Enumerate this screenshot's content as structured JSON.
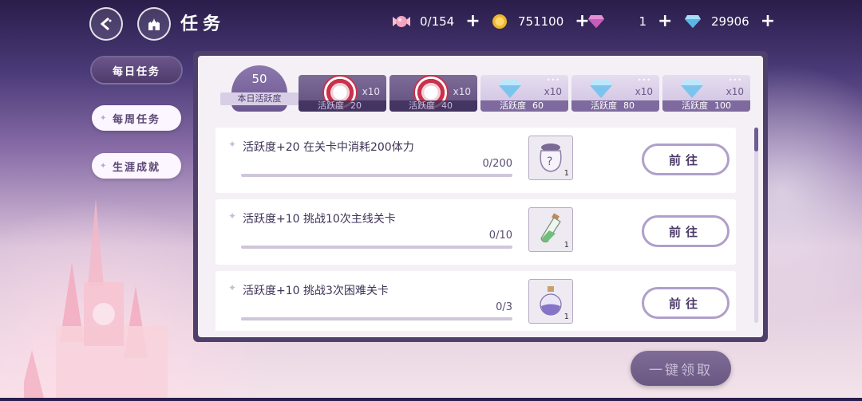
{
  "header": {
    "title": "任务"
  },
  "currencies": [
    {
      "icon": "candy-icon",
      "value": "0/154"
    },
    {
      "icon": "gold-coin-icon",
      "value": "751100"
    },
    {
      "icon": "pink-diamond-icon",
      "value": "1"
    },
    {
      "icon": "blue-diamond-icon",
      "value": "29906"
    }
  ],
  "sidebar": {
    "tabs": [
      {
        "label": "每日任务",
        "active": true
      },
      {
        "label": "每周任务",
        "active": false
      },
      {
        "label": "生涯成就",
        "active": false
      }
    ]
  },
  "activity": {
    "score": "50",
    "score_label": "本日活跃度",
    "tiers": [
      {
        "label": "活跃度",
        "value": "20",
        "qty": "x10",
        "claimed": true
      },
      {
        "label": "活跃度",
        "value": "40",
        "qty": "x10",
        "claimed": true
      },
      {
        "label": "活跃度",
        "value": "60",
        "qty": "x10",
        "claimed": false
      },
      {
        "label": "活跃度",
        "value": "80",
        "qty": "x10",
        "claimed": false
      },
      {
        "label": "活跃度",
        "value": "100",
        "qty": "x10",
        "claimed": false
      }
    ]
  },
  "tasks": [
    {
      "title": "活跃度+20 在关卡中消耗200体力",
      "progress": "0/200",
      "progress_fraction": 0,
      "reward_icon": "mystery-bag-icon",
      "reward_count": "1",
      "button": "前往"
    },
    {
      "title": "活跃度+10 挑战10次主线关卡",
      "progress": "0/10",
      "progress_fraction": 0,
      "reward_icon": "potion-vial-icon",
      "reward_count": "1",
      "button": "前往"
    },
    {
      "title": "活跃度+10 挑战3次困难关卡",
      "progress": "0/3",
      "progress_fraction": 0,
      "reward_icon": "potion-flask-icon",
      "reward_count": "1",
      "button": "前往"
    }
  ],
  "footer": {
    "claim_all": "一键领取"
  },
  "colors": {
    "panel": "#4e3f6b",
    "accent": "#7a6598",
    "button_border": "#b09fcb"
  }
}
